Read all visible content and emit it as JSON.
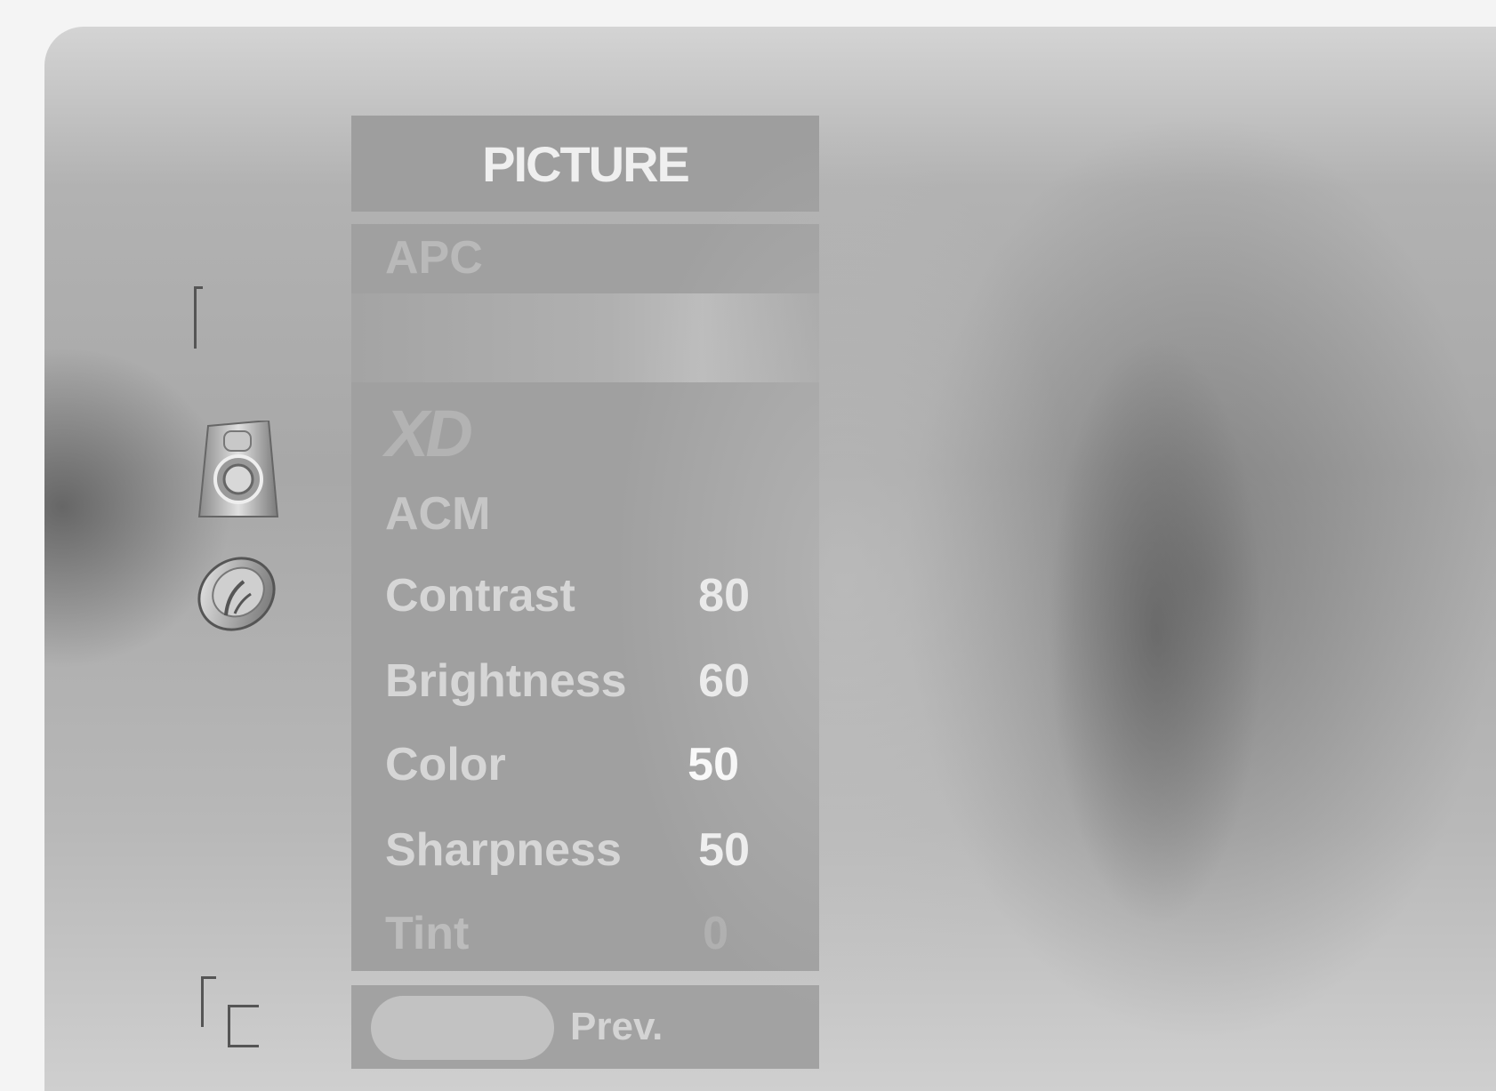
{
  "menu": {
    "title": "PICTURE",
    "items": [
      {
        "label": "APC",
        "value": ""
      },
      {
        "label": "",
        "value": ""
      },
      {
        "label": "XD",
        "value": ""
      },
      {
        "label": "ACM",
        "value": ""
      },
      {
        "label": "Contrast",
        "value": "80"
      },
      {
        "label": "Brightness",
        "value": "60"
      },
      {
        "label": "Color",
        "value": "50"
      },
      {
        "label": "Sharpness",
        "value": "50"
      },
      {
        "label": "Tint",
        "value": "0"
      }
    ],
    "footer": {
      "prev_label": "Prev."
    }
  },
  "side_icons": [
    "bracket-icon",
    "speaker-icon",
    "clock-icon",
    "pip-icon"
  ]
}
